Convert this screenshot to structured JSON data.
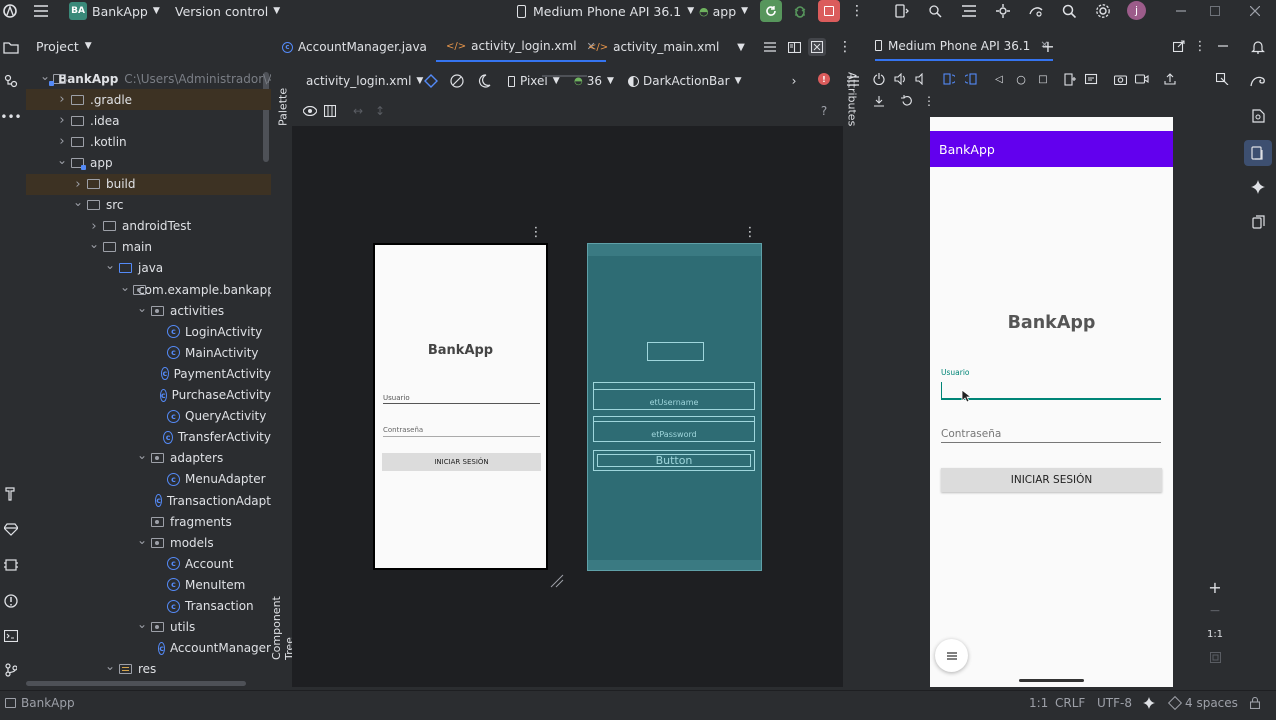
{
  "titlebar": {
    "project_badge": "BA",
    "project_name": "BankApp",
    "vcs": "Version control",
    "device": "Medium Phone API 36.1",
    "run_config": "app",
    "user_initial": "j"
  },
  "project_panel": {
    "title": "Project",
    "root": {
      "name": "BankApp",
      "path": "C:\\Users\\Administrador\\And"
    },
    "items": [
      {
        "label": "BankApp"
      },
      {
        "label": ".gradle"
      },
      {
        "label": ".idea"
      },
      {
        "label": ".kotlin"
      },
      {
        "label": "app"
      },
      {
        "label": "build"
      },
      {
        "label": "src"
      },
      {
        "label": "androidTest"
      },
      {
        "label": "main"
      },
      {
        "label": "java"
      },
      {
        "label": "com.example.bankapp"
      },
      {
        "label": "activities"
      },
      {
        "label": "LoginActivity"
      },
      {
        "label": "MainActivity"
      },
      {
        "label": "PaymentActivity"
      },
      {
        "label": "PurchaseActivity"
      },
      {
        "label": "QueryActivity"
      },
      {
        "label": "TransferActivity"
      },
      {
        "label": "adapters"
      },
      {
        "label": "MenuAdapter"
      },
      {
        "label": "TransactionAdapt"
      },
      {
        "label": "fragments"
      },
      {
        "label": "models"
      },
      {
        "label": "Account"
      },
      {
        "label": "MenuItem"
      },
      {
        "label": "Transaction"
      },
      {
        "label": "utils"
      },
      {
        "label": "AccountManager"
      },
      {
        "label": "res"
      }
    ]
  },
  "editor_tabs": [
    {
      "label": "AccountManager.java"
    },
    {
      "label": "activity_login.xml"
    },
    {
      "label": "activity_main.xml"
    }
  ],
  "layout_toolbar": {
    "file": "activity_login.xml",
    "device": "Pixel",
    "api": "36",
    "theme": "DarkActionBar"
  },
  "side_tabs": {
    "palette": "Palette",
    "component_tree": "Component Tree",
    "attributes": "Attributes"
  },
  "design_preview": {
    "title": "BankApp",
    "username_hint": "Usuario",
    "password_hint": "Contraseña",
    "button": "INICIAR SESIÓN"
  },
  "blueprint": {
    "username_id": "etUsername",
    "password_id": "etPassword",
    "button_text": "Button"
  },
  "running_devices": {
    "tab": "Medium Phone API 36.1",
    "app_bar_title": "BankApp",
    "title": "BankApp",
    "username_label": "Usuario",
    "password_hint": "Contraseña",
    "button": "INICIAR SESIÓN",
    "zoom_ratio": "1:1",
    "colors": {
      "action_bar": "#6200ee",
      "input_focus": "#008577"
    }
  },
  "statusbar": {
    "project": "BankApp",
    "position": "1:1",
    "line_sep": "CRLF",
    "encoding": "UTF-8",
    "indent": "4 spaces"
  }
}
